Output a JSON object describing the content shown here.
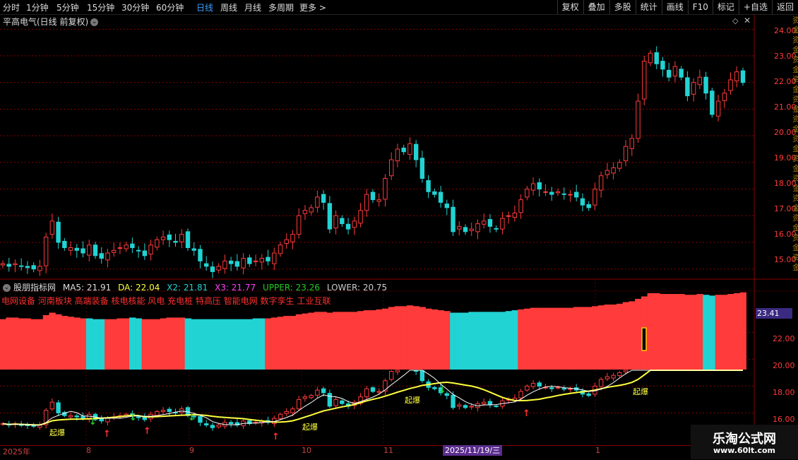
{
  "toolbar": {
    "periods": [
      "分时",
      "1分钟",
      "5分钟",
      "15分钟",
      "30分钟",
      "60分钟",
      "日线",
      "周线",
      "月线",
      "多周期",
      "更多 >"
    ],
    "active_period": "日线",
    "right_buttons": [
      "复权",
      "叠加",
      "多股",
      "统计",
      "画线",
      "F10",
      "标记",
      "+自选",
      "返回"
    ]
  },
  "stock": {
    "title": "平高电气(日线 前复权)"
  },
  "main_axis": {
    "labels": [
      "24.00",
      "23.00",
      "22.00",
      "21.00",
      "20.00",
      "19.00",
      "18.00",
      "17.00",
      "16.00",
      "15.00"
    ]
  },
  "indicator": {
    "name": "股朋指标网",
    "values": [
      {
        "label": "MA5: 21.91",
        "color": "#dddddd"
      },
      {
        "label": "DA: 22.04",
        "color": "#ffff40"
      },
      {
        "label": "X2: 21.81",
        "color": "#22d3d3"
      },
      {
        "label": "X3: 21.77",
        "color": "#ff40ff"
      },
      {
        "label": "UPPER: 23.26",
        "color": "#22cc22"
      },
      {
        "label": "LOWER: 20.75",
        "color": "#cccccc"
      }
    ],
    "concepts": "电网设备 河南板块 高端装备 核电核能 风电 充电桩 特高压 智能电网 数字孪生 工业互联",
    "axis_labels": [
      "22.00",
      "20.00",
      "18.00",
      "16.00"
    ],
    "price_tag": "23.41",
    "signal_label": "起爆"
  },
  "timeline": {
    "ticks": [
      "2025年",
      "8",
      "9",
      "10",
      "11",
      "1"
    ],
    "highlight": "2025/11/19/三"
  },
  "watermark": {
    "title": "乐淘公式网",
    "url": "www.60lt.com"
  },
  "colors": {
    "up": "#ff3b3b",
    "down": "#22d3d3",
    "ma_yellow": "#ffff40",
    "ma_white": "#ffffff",
    "grid": "#8b0000"
  },
  "chart_data": {
    "type": "candlestick",
    "ylim": [
      14.7,
      24.3
    ],
    "closes": [
      15.2,
      15.1,
      15.2,
      15.1,
      15.05,
      15.0,
      15.1,
      16.2,
      16.8,
      16.0,
      15.8,
      15.8,
      15.7,
      15.6,
      15.9,
      15.5,
      15.4,
      15.6,
      15.7,
      15.8,
      15.9,
      15.8,
      15.7,
      15.5,
      15.9,
      16.1,
      16.2,
      16.1,
      16.0,
      16.3,
      15.8,
      15.7,
      15.3,
      15.1,
      14.9,
      15.1,
      15.3,
      15.2,
      15.1,
      15.4,
      15.2,
      15.3,
      15.4,
      15.3,
      15.6,
      15.9,
      16.1,
      16.3,
      17.0,
      17.2,
      17.3,
      17.7,
      17.5,
      16.5,
      17.0,
      16.7,
      16.5,
      16.8,
      17.2,
      17.8,
      17.6,
      17.6,
      18.4,
      19.1,
      19.5,
      19.4,
      19.7,
      19.1,
      18.4,
      17.9,
      17.8,
      17.5,
      17.3,
      16.4,
      16.6,
      16.4,
      16.5,
      16.7,
      16.8,
      16.6,
      16.5,
      16.9,
      17.0,
      17.1,
      17.6,
      18.0,
      18.2,
      18.0,
      17.9,
      17.8,
      17.9,
      17.8,
      17.8,
      17.7,
      17.4,
      17.3,
      18.0,
      18.5,
      18.7,
      18.8,
      19.0,
      19.6,
      19.9,
      21.3,
      22.8,
      23.1,
      22.7,
      22.5,
      22.2,
      22.6,
      22.2,
      21.5,
      22.0,
      22.2,
      21.6,
      20.8,
      21.3,
      21.6,
      22.1,
      22.4,
      22.0
    ],
    "volumes": [
      0.62,
      0.64,
      0.64,
      0.63,
      0.63,
      0.62,
      0.62,
      0.67,
      0.7,
      0.68,
      0.66,
      0.65,
      0.64,
      0.63,
      0.63,
      0.62,
      0.62,
      0.62,
      0.62,
      0.63,
      0.63,
      0.64,
      0.63,
      0.62,
      0.62,
      0.62,
      0.63,
      0.64,
      0.64,
      0.64,
      0.63,
      0.62,
      0.62,
      0.62,
      0.62,
      0.62,
      0.62,
      0.62,
      0.62,
      0.62,
      0.62,
      0.63,
      0.63,
      0.63,
      0.64,
      0.65,
      0.66,
      0.66,
      0.68,
      0.69,
      0.7,
      0.71,
      0.71,
      0.7,
      0.71,
      0.71,
      0.71,
      0.71,
      0.72,
      0.73,
      0.73,
      0.74,
      0.75,
      0.77,
      0.78,
      0.78,
      0.79,
      0.78,
      0.77,
      0.75,
      0.74,
      0.73,
      0.72,
      0.7,
      0.7,
      0.7,
      0.71,
      0.71,
      0.71,
      0.71,
      0.71,
      0.71,
      0.72,
      0.73,
      0.74,
      0.75,
      0.76,
      0.76,
      0.76,
      0.76,
      0.76,
      0.76,
      0.76,
      0.77,
      0.77,
      0.77,
      0.78,
      0.79,
      0.8,
      0.8,
      0.81,
      0.83,
      0.84,
      0.87,
      0.9,
      0.94,
      0.94,
      0.93,
      0.93,
      0.93,
      0.93,
      0.92,
      0.92,
      0.93,
      0.92,
      0.91,
      0.92,
      0.92,
      0.93,
      0.94,
      0.95
    ],
    "xlabel": "",
    "ylabel": ""
  }
}
